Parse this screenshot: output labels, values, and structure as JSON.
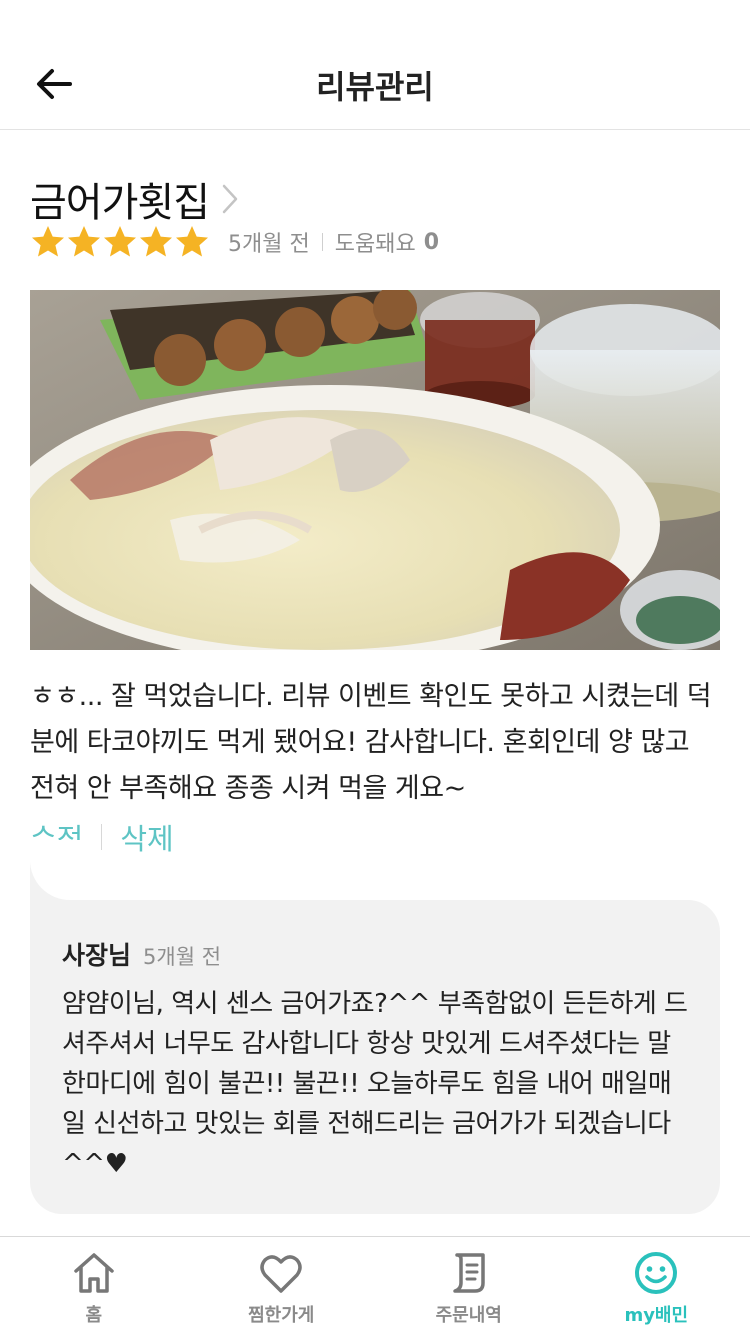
{
  "header": {
    "title": "리뷰관리"
  },
  "review": {
    "store_name": "금어가횟집",
    "rating": 5,
    "date": "5개월 전",
    "helpful_label": "도움돼요",
    "helpful_count": "0",
    "photo_icon": "food-photo",
    "text": "ㅎㅎ... 잘 먹었습니다. 리뷰 이벤트 확인도 못하고 시켰는데 덕분에 타코야끼도 먹게 됐어요! 감사합니다. 혼회인데 양 많고 전혀 안 부족해요 종종 시켜 먹을 게요~",
    "edit_label": "수정",
    "delete_label": "삭제"
  },
  "reply": {
    "author": "사장님",
    "date": "5개월 전",
    "text": "얌얌이님, 역시 센스 금어가죠?^^ 부족함없이 든든하게 드셔주셔서 너무도 감사합니다 항상 맛있게 드셔주셨다는 말 한마디에 힘이 불끈!! 불끈!! 오늘하루도 힘을 내어 매일매일 신선하고 맛있는 회를 전해드리는 금어가가 되겠습니다^^♥"
  },
  "tabs": [
    {
      "label": "홈",
      "icon": "home-icon",
      "active": false
    },
    {
      "label": "찜한가게",
      "icon": "heart-icon",
      "active": false
    },
    {
      "label": "주문내역",
      "icon": "receipt-icon",
      "active": false
    },
    {
      "label": "my배민",
      "icon": "smile-icon",
      "active": true
    }
  ],
  "colors": {
    "accent": "#2ac1bc",
    "link": "#5ec4c4",
    "star": "#f5b324"
  }
}
